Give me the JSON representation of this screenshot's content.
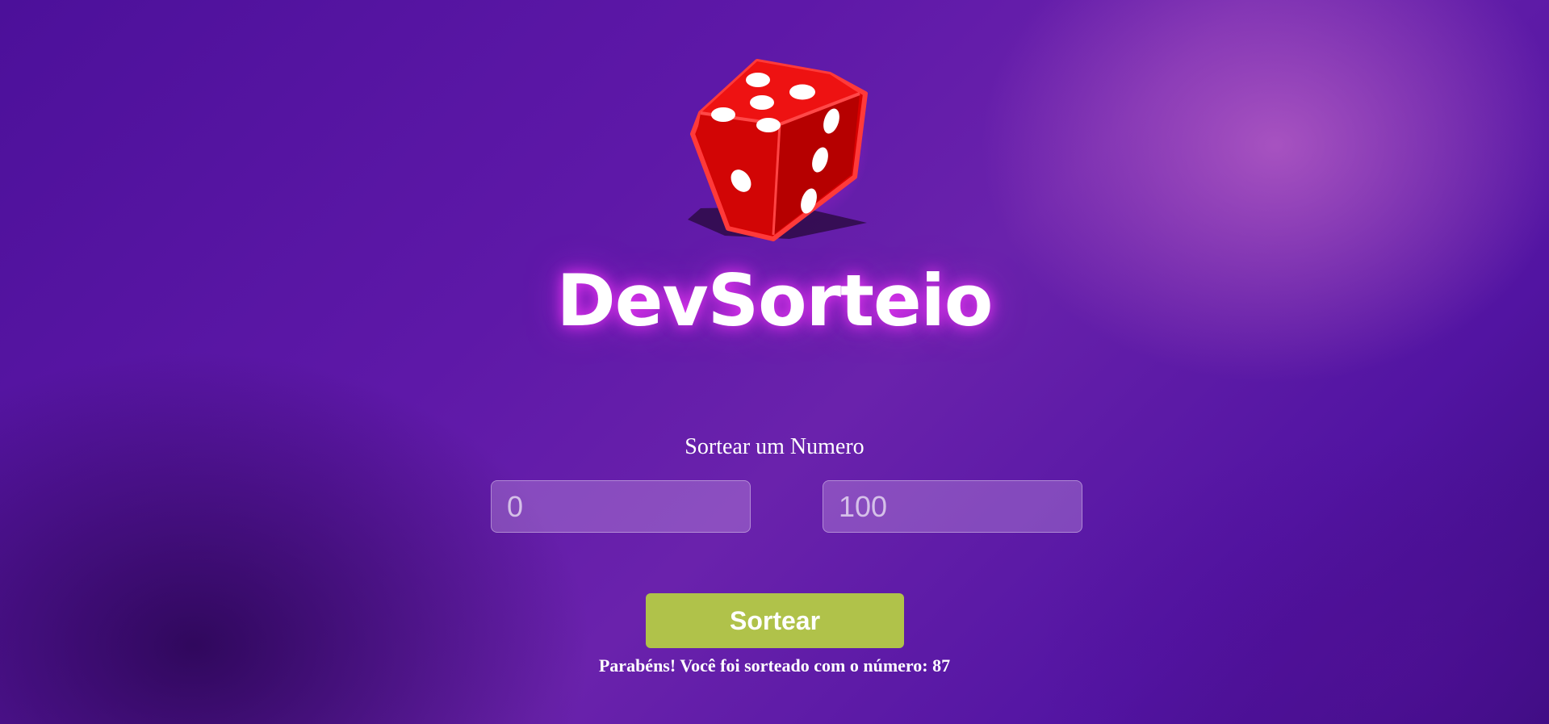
{
  "hero": {
    "logo_icon": "dice-icon",
    "brand_name": "DevSorteio",
    "accent_glow": "#e030f0"
  },
  "draw": {
    "title": "Sortear um Numero",
    "min_placeholder": "0",
    "max_placeholder": "100",
    "button_label": "Sortear",
    "button_color": "#b0c24a",
    "result_text": "Parabéns! Você foi sorteado com o número: 87"
  }
}
